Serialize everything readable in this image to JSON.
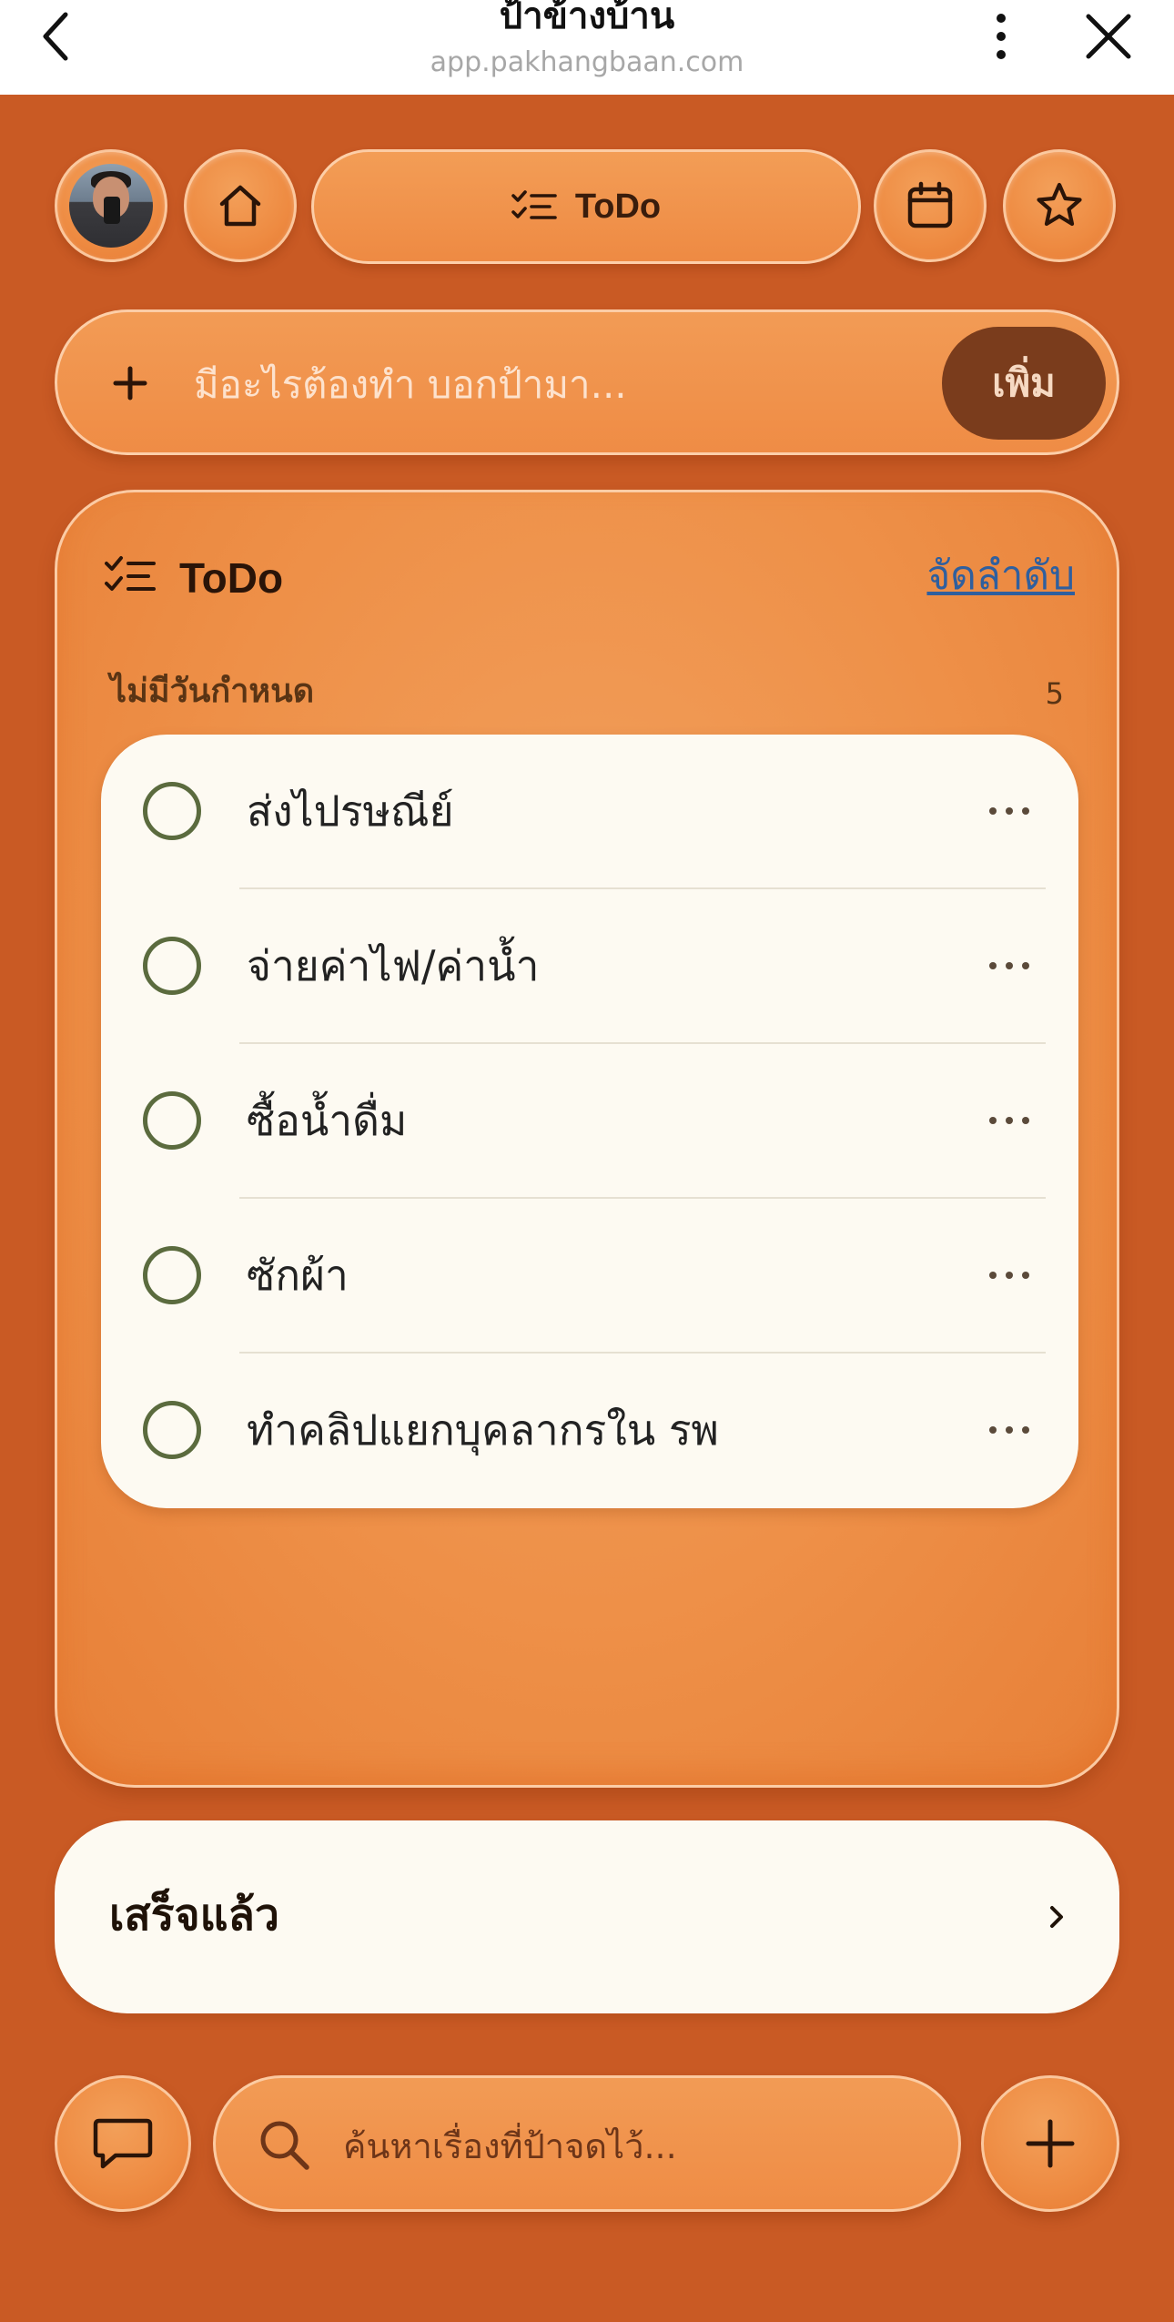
{
  "browser": {
    "title": "ป้าข้างบ้าน",
    "url": "app.pakhangbaan.com"
  },
  "nav": {
    "active_tab": "ToDo"
  },
  "add_task": {
    "placeholder": "มีอะไรต้องทำ บอกป้ามา...",
    "submit_label": "เพิ่ม"
  },
  "todo_card": {
    "title": "ToDo",
    "sort_label": "จัดลำดับ",
    "section": {
      "title": "ไม่มีวันกำหนด",
      "count": "5",
      "tasks": [
        {
          "text": "ส่งไปรษณีย์"
        },
        {
          "text": "จ่ายค่าไฟ/ค่าน้ำ"
        },
        {
          "text": "ซื้อน้ำดื่ม"
        },
        {
          "text": "ซักผ้า"
        },
        {
          "text": "ทำคลิปแยกบุคลากรใน รพ"
        }
      ]
    }
  },
  "completed": {
    "label": "เสร็จแล้ว"
  },
  "search": {
    "placeholder": "ค้นหาเรื่องที่ป้าจดไว้..."
  },
  "colors": {
    "background": "#c95a24",
    "accent_orange": "#ee8b42",
    "submit_button": "#7a3c1c",
    "card_surface": "#fdfaf2",
    "checkbox_ring": "#5b6b3e",
    "link": "#2f5f9e"
  }
}
